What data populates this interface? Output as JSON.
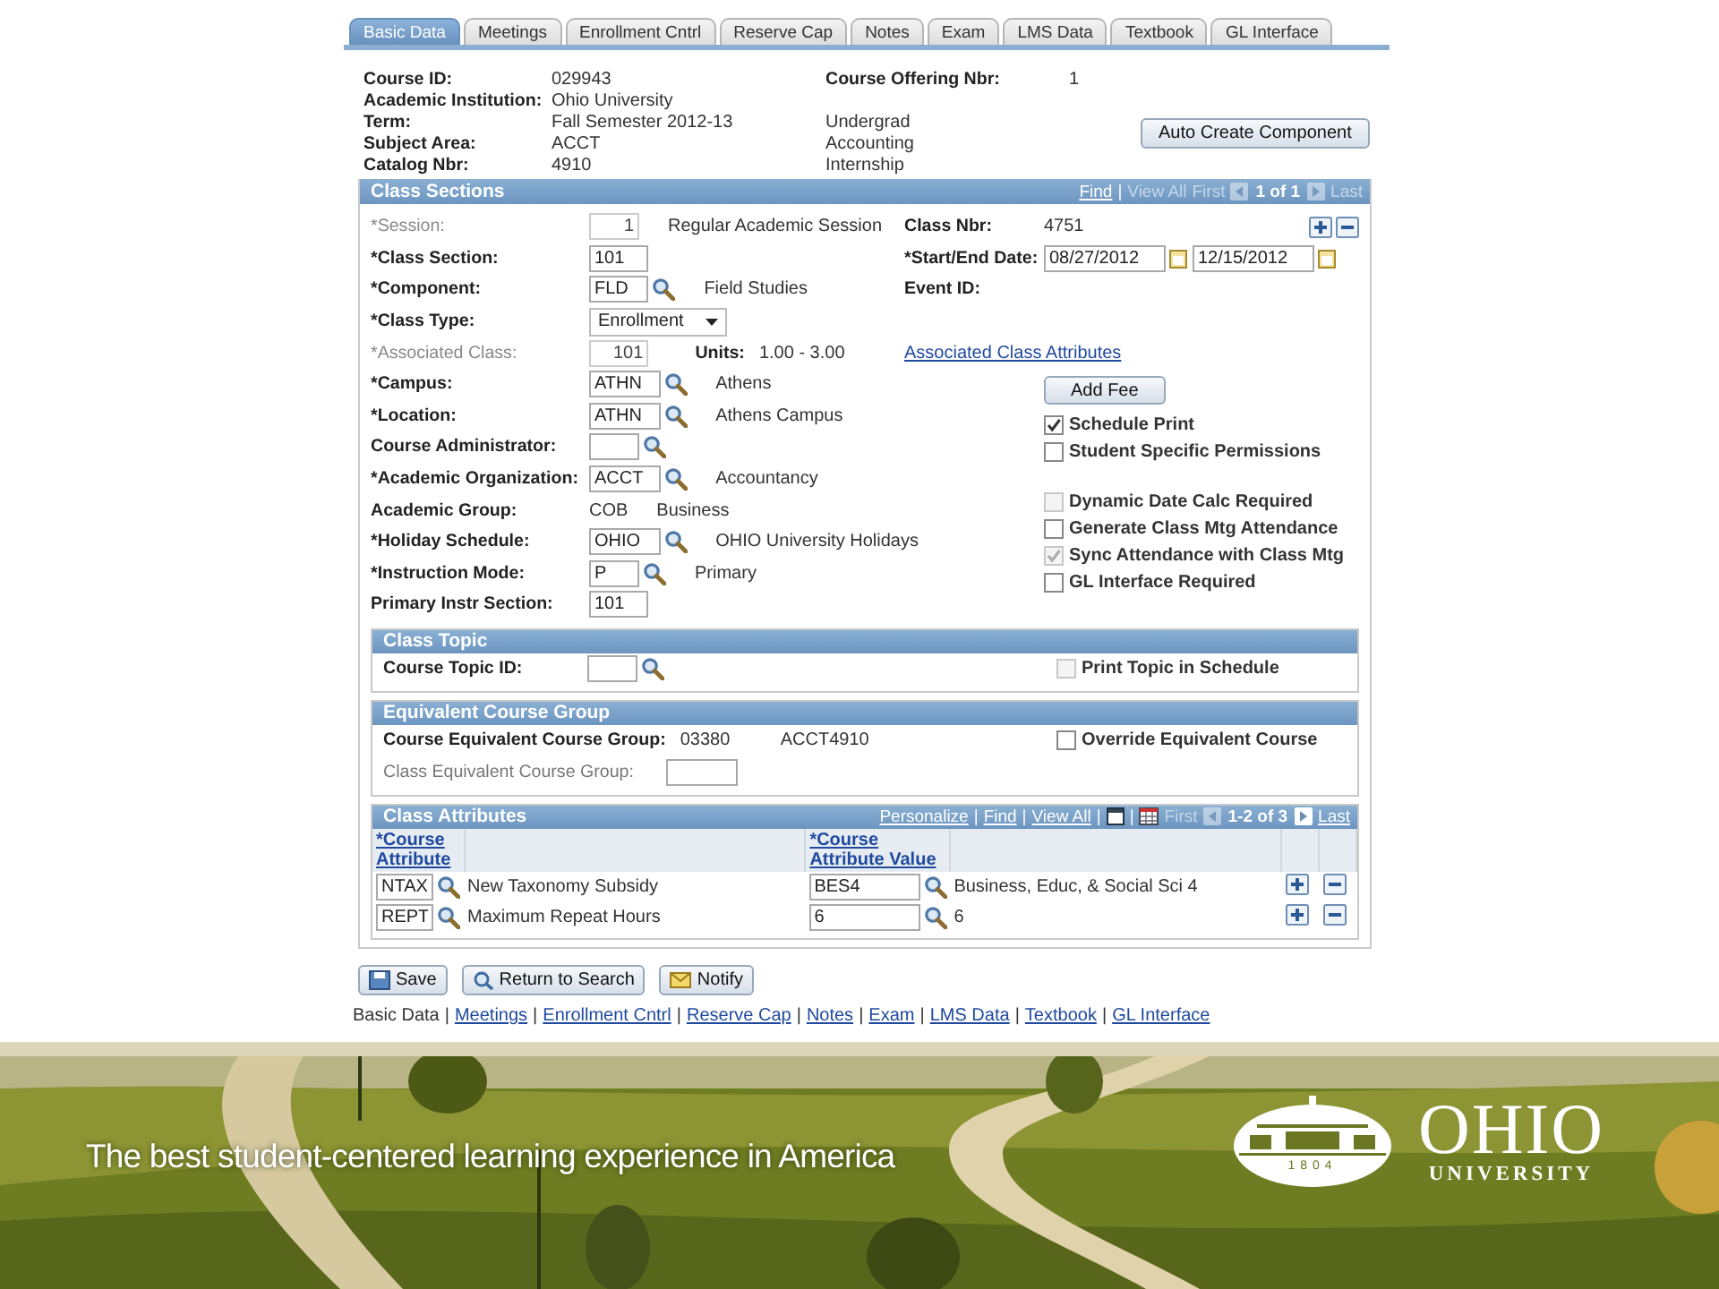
{
  "tabs": [
    {
      "label": "Basic Data",
      "selected": true
    },
    {
      "label": "Meetings",
      "selected": false
    },
    {
      "label": "Enrollment Cntrl",
      "selected": false
    },
    {
      "label": "Reserve Cap",
      "selected": false
    },
    {
      "label": "Notes",
      "selected": false
    },
    {
      "label": "Exam",
      "selected": false
    },
    {
      "label": "LMS Data",
      "selected": false
    },
    {
      "label": "Textbook",
      "selected": false
    },
    {
      "label": "GL Interface",
      "selected": false
    }
  ],
  "course": {
    "fields": [
      {
        "label": "Course ID:",
        "value": "029943"
      },
      {
        "label": "Academic Institution:",
        "value": "Ohio University"
      },
      {
        "label": "Term:",
        "value": "Fall Semester 2012-13"
      },
      {
        "label": "Subject Area:",
        "value": "ACCT"
      },
      {
        "label": "Catalog Nbr:",
        "value": "4910"
      }
    ],
    "offering": {
      "label": "Course Offering Nbr:",
      "value": "1"
    },
    "descriptions": [
      "Undergrad",
      "Accounting",
      "Internship"
    ],
    "button": "Auto Create Component"
  },
  "class_sections": {
    "title": "Class Sections",
    "nav": [
      {
        "kind": "link",
        "text": "Find",
        "disabled": false
      },
      {
        "kind": "separator",
        "text": "|"
      },
      {
        "kind": "link",
        "text": "View All",
        "disabled": true
      },
      {
        "kind": "link",
        "text": "First",
        "disabled": true
      },
      {
        "kind": "prev",
        "disabled": true
      },
      {
        "kind": "count",
        "text": "1 of 1"
      },
      {
        "kind": "next",
        "disabled": true
      },
      {
        "kind": "link",
        "text": "Last",
        "disabled": true
      }
    ],
    "fields": [
      {
        "label": "*Session:",
        "kind": "input",
        "value": "1",
        "description": "Regular Academic Session",
        "disabled": true
      },
      {
        "label": "*Class Section:",
        "kind": "input",
        "value": "101",
        "disabled": false
      },
      {
        "label": "*Component:",
        "kind": "lookup",
        "value": "FLD",
        "description": "Field Studies",
        "disabled": false
      },
      {
        "label": "*Class Type:",
        "kind": "select",
        "value": "Enrollment",
        "disabled": false
      },
      {
        "label": "*Associated Class:",
        "kind": "input",
        "value": "101",
        "units": {
          "label": "Units:",
          "value": "1.00 - 3.00"
        },
        "disabled": true
      },
      {
        "label": "*Campus:",
        "kind": "lookup",
        "value": "ATHN",
        "description": "Athens",
        "disabled": false
      },
      {
        "label": "*Location:",
        "kind": "lookup",
        "value": "ATHN",
        "description": "Athens Campus",
        "disabled": false
      },
      {
        "label": "Course Administrator:",
        "kind": "lookup",
        "disabled": false
      },
      {
        "label": "*Academic Organization:",
        "kind": "lookup",
        "value": "ACCT",
        "description": "Accountancy",
        "disabled": false
      },
      {
        "label": "Academic Group:",
        "kind": "text",
        "value": "COB",
        "description": "Business",
        "disabled": false
      },
      {
        "label": "*Holiday Schedule:",
        "kind": "lookup",
        "value": "OHIO",
        "description": "OHIO University Holidays",
        "disabled": false
      },
      {
        "label": "*Instruction Mode:",
        "kind": "lookup",
        "value": "P",
        "description": "Primary",
        "disabled": false
      },
      {
        "label": "Primary Instr Section:",
        "kind": "input",
        "value": "101",
        "disabled": false
      }
    ],
    "class_nbr": {
      "label": "Class Nbr:",
      "value": "4751"
    },
    "dates": {
      "label": "*Start/End Date:",
      "start": "08/27/2012",
      "end": "12/15/2012"
    },
    "event_id": {
      "label": "Event ID:"
    },
    "attributes_link": "Associated Class Attributes",
    "add_fee": "Add Fee",
    "options": [
      {
        "label": "Schedule Print",
        "checked": true,
        "disabled": false
      },
      {
        "label": "Student Specific Permissions",
        "checked": false,
        "disabled": false
      }
    ],
    "attendance_options": [
      {
        "label": "Dynamic Date Calc Required",
        "checked": false,
        "disabled": true
      },
      {
        "label": "Generate Class Mtg Attendance",
        "checked": false,
        "disabled": false
      },
      {
        "label": "Sync Attendance with Class Mtg",
        "checked": true,
        "disabled": true
      },
      {
        "label": "GL Interface Required",
        "checked": false,
        "disabled": false
      }
    ]
  },
  "class_topic": {
    "title": "Class Topic",
    "label": "Course Topic ID:",
    "option": {
      "label": "Print Topic in Schedule",
      "checked": false,
      "disabled": true
    }
  },
  "equivalent_group": {
    "title": "Equivalent Course Group",
    "course_label": "Course Equivalent Course Group:",
    "course_group": "03380",
    "course_description": "ACCT4910",
    "class_label": "Class Equivalent Course Group:",
    "class_field_disabled": true,
    "option": {
      "label": "Override Equivalent Course",
      "checked": false,
      "disabled": false
    }
  },
  "class_attributes": {
    "title": "Class Attributes",
    "nav": [
      {
        "kind": "link",
        "text": "Personalize",
        "disabled": false
      },
      {
        "kind": "separator",
        "text": "|"
      },
      {
        "kind": "link",
        "text": "Find",
        "disabled": false
      },
      {
        "kind": "separator",
        "text": "|"
      },
      {
        "kind": "link",
        "text": "View All",
        "disabled": false
      },
      {
        "kind": "separator",
        "text": "|"
      },
      {
        "kind": "window"
      },
      {
        "kind": "separator",
        "text": "|"
      },
      {
        "kind": "grid"
      },
      {
        "kind": "link",
        "text": "First",
        "disabled": true
      },
      {
        "kind": "prev",
        "disabled": true
      },
      {
        "kind": "count",
        "text": "1-2 of 3"
      },
      {
        "kind": "next",
        "disabled": false
      },
      {
        "kind": "link",
        "text": "Last",
        "disabled": false
      }
    ],
    "columns": [
      "*Course Attribute",
      "*Course Attribute Value"
    ],
    "rows": [
      {
        "code": "NTAX",
        "description": "New Taxonomy Subsidy",
        "value": "BES4",
        "value_description": "Business, Educ, & Social Sci 4"
      },
      {
        "code": "REPT",
        "description": "Maximum Repeat Hours",
        "value": "6",
        "value_description": "6"
      }
    ]
  },
  "buttons": [
    {
      "kind": "save",
      "label": "Save"
    },
    {
      "kind": "return",
      "label": "Return to Search"
    },
    {
      "kind": "notify",
      "label": "Notify"
    }
  ],
  "footer_links": {
    "separator": "|",
    "items": [
      {
        "text": "Basic Data",
        "current": true
      },
      {
        "text": "Meetings",
        "current": false
      },
      {
        "text": "Enrollment Cntrl",
        "current": false
      },
      {
        "text": "Reserve Cap",
        "current": false
      },
      {
        "text": "Notes",
        "current": false
      },
      {
        "text": "Exam",
        "current": false
      },
      {
        "text": "LMS Data",
        "current": false
      },
      {
        "text": "Textbook",
        "current": false
      },
      {
        "text": "GL Interface",
        "current": false
      }
    ]
  },
  "banner": {
    "kind": "picture",
    "tagline": "The best student-centered learning experience in America",
    "logo": {
      "year": "1804",
      "name": "OHIO",
      "subtitle": "UNIVERSITY"
    }
  }
}
